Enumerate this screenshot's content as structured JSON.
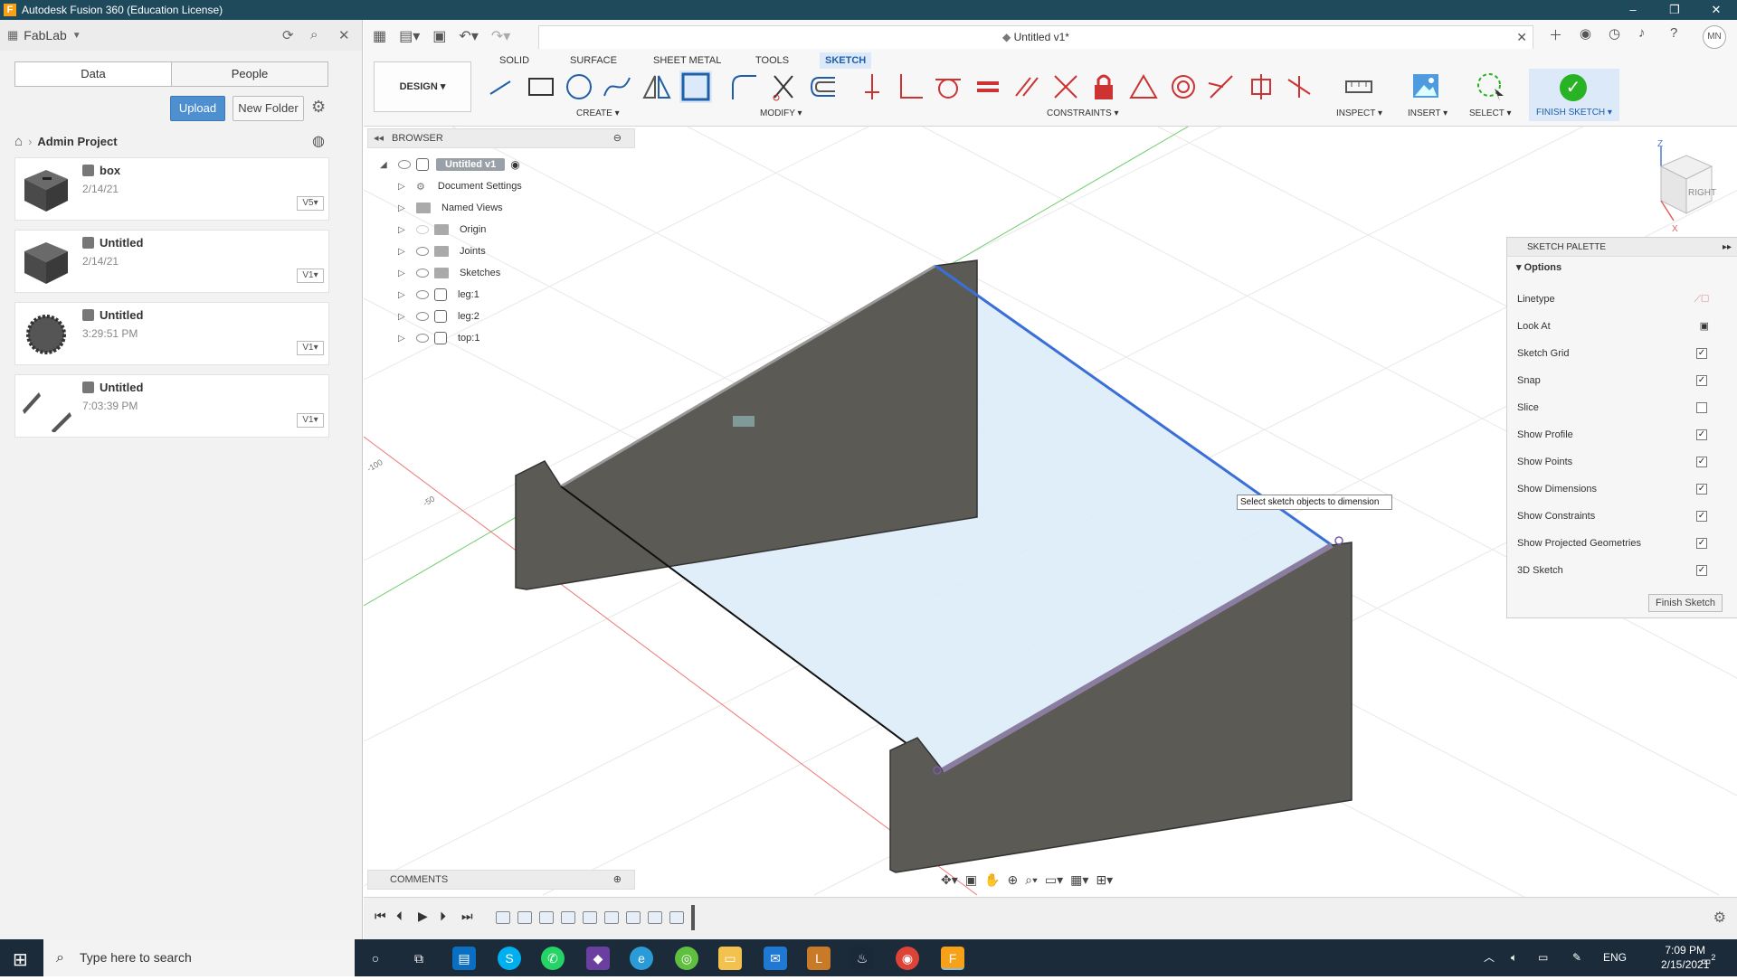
{
  "window": {
    "title": "Autodesk Fusion 360 (Education License)",
    "app_icon": "F"
  },
  "data_panel": {
    "team": "FabLab",
    "tabs": [
      "Data",
      "People"
    ],
    "upload_label": "Upload",
    "new_folder_label": "New Folder",
    "breadcrumb": "Admin Project",
    "files": [
      {
        "name": "box",
        "date": "2/14/21",
        "version": "V5"
      },
      {
        "name": "Untitled",
        "date": "2/14/21",
        "version": "V1"
      },
      {
        "name": "Untitled",
        "date": "3:29:51 PM",
        "version": "V1"
      },
      {
        "name": "Untitled",
        "date": "7:03:39 PM",
        "version": "V1"
      }
    ]
  },
  "document": {
    "tab_title": "Untitled v1*"
  },
  "user": {
    "initials": "MN"
  },
  "ribbon": {
    "workspace": "DESIGN",
    "tabs": [
      "SOLID",
      "SURFACE",
      "SHEET METAL",
      "TOOLS",
      "SKETCH"
    ],
    "active_tab": "SKETCH",
    "groups": [
      "CREATE",
      "MODIFY",
      "CONSTRAINTS",
      "INSPECT",
      "INSERT",
      "SELECT"
    ],
    "finish_sketch": "FINISH SKETCH"
  },
  "browser": {
    "title": "BROWSER",
    "root": "Untitled v1",
    "nodes": [
      "Document Settings",
      "Named Views",
      "Origin",
      "Joints",
      "Sketches",
      "leg:1",
      "leg:2",
      "top:1"
    ]
  },
  "viewcube": {
    "face": "RIGHT",
    "axis_z": "Z",
    "axis_x": "X"
  },
  "sketch_palette": {
    "title": "SKETCH PALETTE",
    "section": "Options",
    "rows": [
      {
        "label": "Linetype",
        "type": "icon"
      },
      {
        "label": "Look At",
        "type": "icon"
      },
      {
        "label": "Sketch Grid",
        "checked": "✓"
      },
      {
        "label": "Snap",
        "checked": "✓"
      },
      {
        "label": "Slice",
        "checked": ""
      },
      {
        "label": "Show Profile",
        "checked": "✓"
      },
      {
        "label": "Show Points",
        "checked": "✓"
      },
      {
        "label": "Show Dimensions",
        "checked": "✓"
      },
      {
        "label": "Show Constraints",
        "checked": "✓"
      },
      {
        "label": "Show Projected Geometries",
        "checked": "✓"
      },
      {
        "label": "3D Sketch",
        "checked": "✓"
      }
    ],
    "finish_button": "Finish Sketch"
  },
  "tooltip": "Select sketch objects to dimension",
  "axis_labels": {
    "a": "-100",
    "b": "-50"
  },
  "comments": "COMMENTS",
  "taskbar": {
    "search_placeholder": "Type here to search",
    "lang": "ENG",
    "time": "7:09 PM",
    "date": "2/15/2021",
    "notif_count": "2"
  },
  "colors": {
    "titlebar": "#1e4a5c",
    "accent": "#1f5fa8",
    "body_fill": "#5c5a55",
    "sketch_fill": "#dcecf7",
    "selected_line": "#3a6fd8"
  }
}
